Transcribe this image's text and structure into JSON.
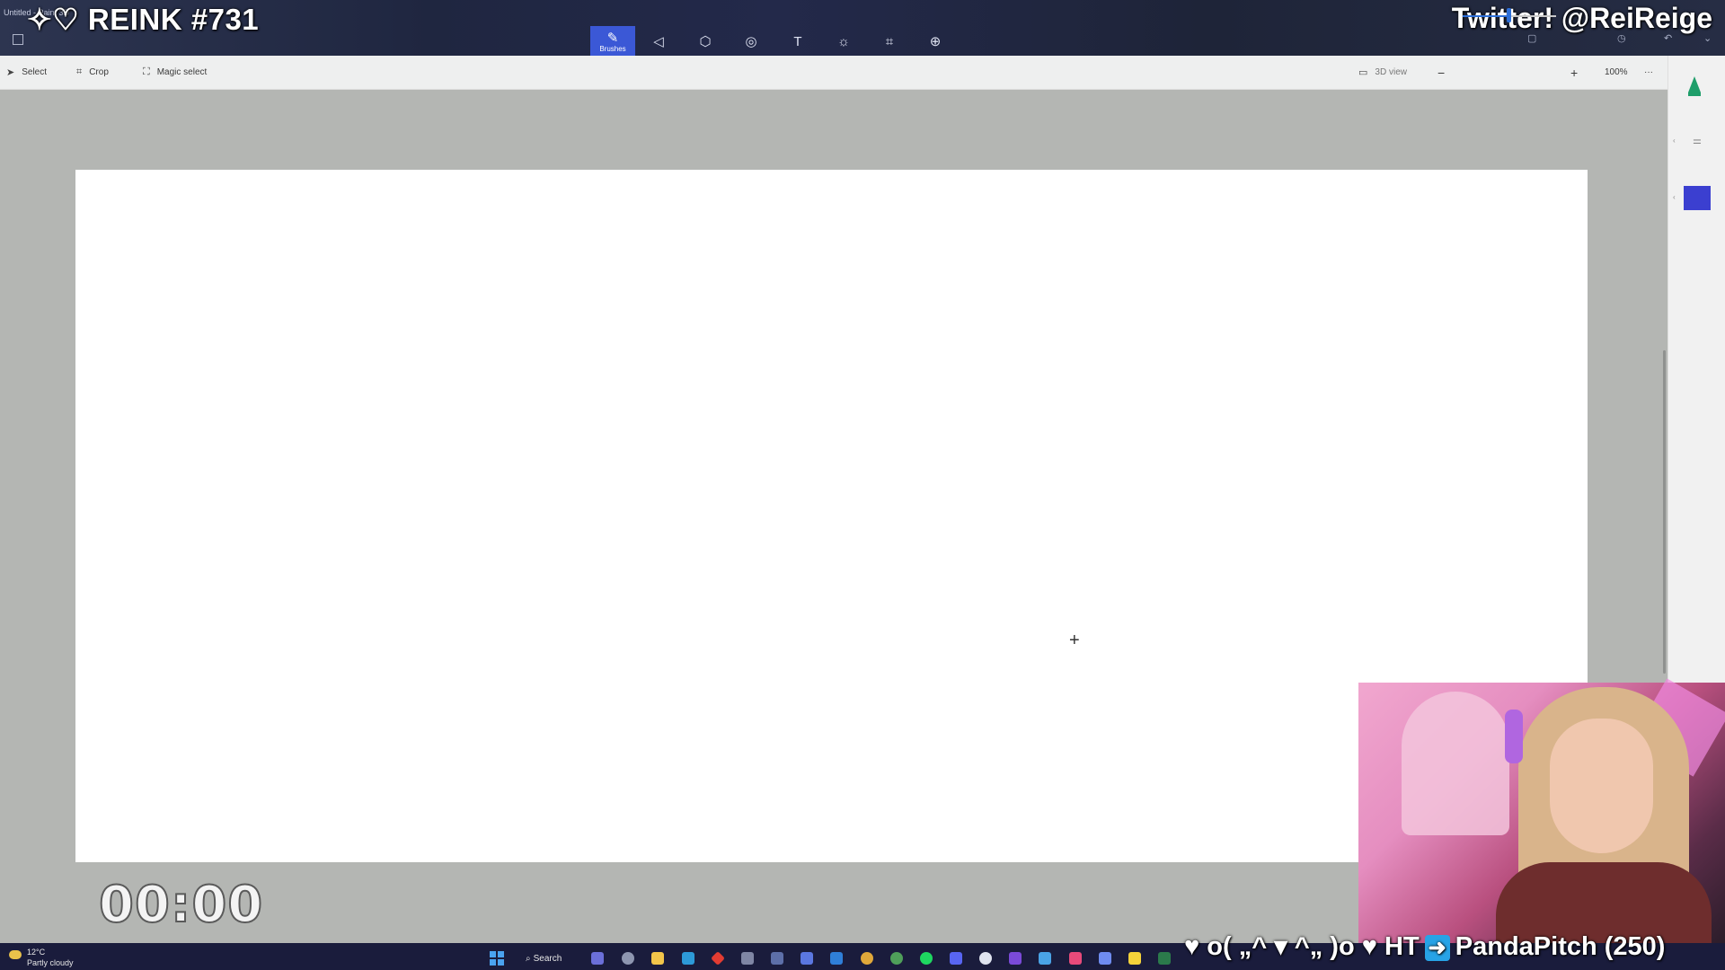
{
  "stream": {
    "title": "✧♡ REINK #731",
    "twitter": "Twitter! @ReiReige",
    "timer": "00:00",
    "chat_text": "♥ o( „^ ▾ ^„ )o ♥ HT",
    "chat_user": "PandaPitch (250)"
  },
  "app": {
    "doc_title": "Untitled - Paint 3D",
    "toolbar": {
      "active_tool_label": "Brushes",
      "tools": [
        "brushes-icon",
        "2d-shapes-icon",
        "3d-shapes-icon",
        "stickers-icon",
        "text-icon",
        "effects-icon",
        "canvas-icon",
        "3d-library-icon"
      ]
    },
    "commands": {
      "select": "Select",
      "crop": "Crop",
      "magic_select": "Magic select",
      "view_3d": "3D view",
      "zoom": "100%",
      "zoom_fraction": 0.5,
      "more": "···"
    },
    "side_panel": {
      "color": "#3b3fd0"
    }
  },
  "taskbar": {
    "weather_temp": "12°C",
    "weather_condition": "Partly cloudy",
    "search_label": "Search"
  },
  "colors": {
    "accent": "#3b58d6",
    "canvas_bg": "#ffffff",
    "workspace_bg": "#b4b6b3",
    "taskbar_bg": "#1a1c3c"
  }
}
